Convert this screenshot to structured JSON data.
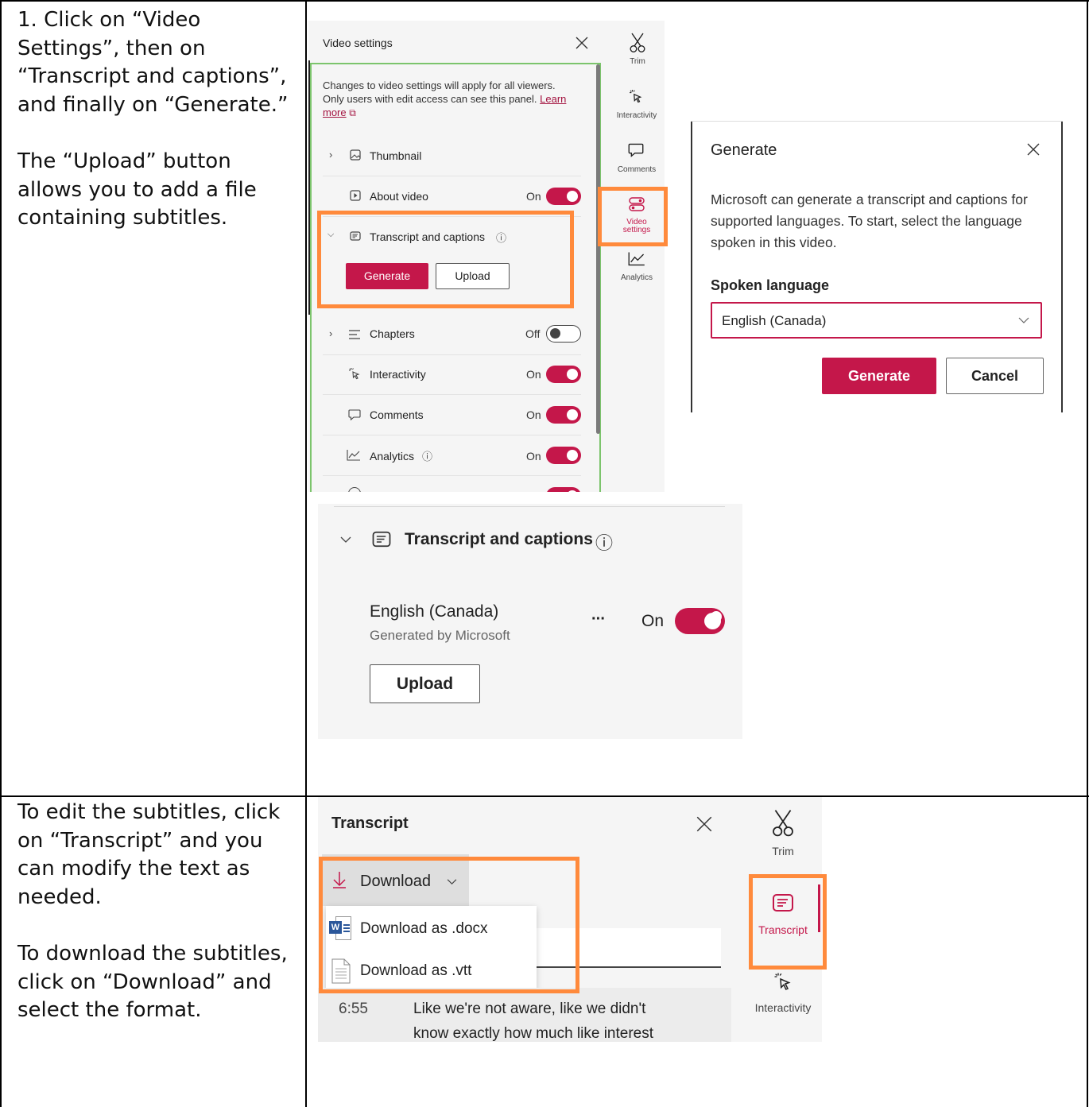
{
  "row1": {
    "instructions": [
      "1. Click on “Video Settings”, then on “Transcript and captions”, and finally on “Generate.”",
      "The “Upload” button allows you to add a file containing subtitles."
    ]
  },
  "row2": {
    "instructions": [
      "To edit the subtitles, click on “Transcript” and you can modify the text as needed.",
      "To download the subtitles, click on “Download” and select the format."
    ]
  },
  "video_settings": {
    "title": "Video settings",
    "description": "Changes to video settings will apply for all viewers. Only users with edit access can see this panel.",
    "learn_more": "Learn more",
    "thumbnail": "Thumbnail",
    "about_video": "About video",
    "about_state": "On",
    "transcript_captions": "Transcript and captions",
    "generate_btn": "Generate",
    "upload_btn": "Upload",
    "chapters": "Chapters",
    "chapters_state": "Off",
    "interactivity": "Interactivity",
    "interactivity_state": "On",
    "comments": "Comments",
    "comments_state": "On",
    "analytics": "Analytics",
    "analytics_state": "On"
  },
  "side_rail": {
    "trim": "Trim",
    "interactivity": "Interactivity",
    "comments": "Comments",
    "video_settings_line1": "Video",
    "video_settings_line2": "settings",
    "analytics": "Analytics"
  },
  "generate_dialog": {
    "title": "Generate",
    "body": "Microsoft can generate a transcript and captions for supported languages. To start, select the language spoken in this video.",
    "spoken_label": "Spoken language",
    "language_value": "English (Canada)",
    "generate_btn": "Generate",
    "cancel_btn": "Cancel"
  },
  "captions_panel": {
    "title": "Transcript and captions",
    "language": "English (Canada)",
    "source": "Generated by Microsoft",
    "more": "···",
    "state": "On",
    "upload_btn": "Upload"
  },
  "transcript_panel": {
    "title": "Transcript",
    "download": "Download",
    "download_docx": "Download as .docx",
    "download_vtt": "Download as .vtt",
    "timestamp": "6:55",
    "line1": "Like we're not aware, like we didn't",
    "line2": "know exactly how much like interest",
    "rail_trim": "Trim",
    "rail_transcript": "Transcript",
    "rail_interactivity": "Interactivity"
  },
  "colors": {
    "accent": "#c4174a",
    "highlight": "#ff8a3c",
    "panel_border": "#7cc46c"
  }
}
